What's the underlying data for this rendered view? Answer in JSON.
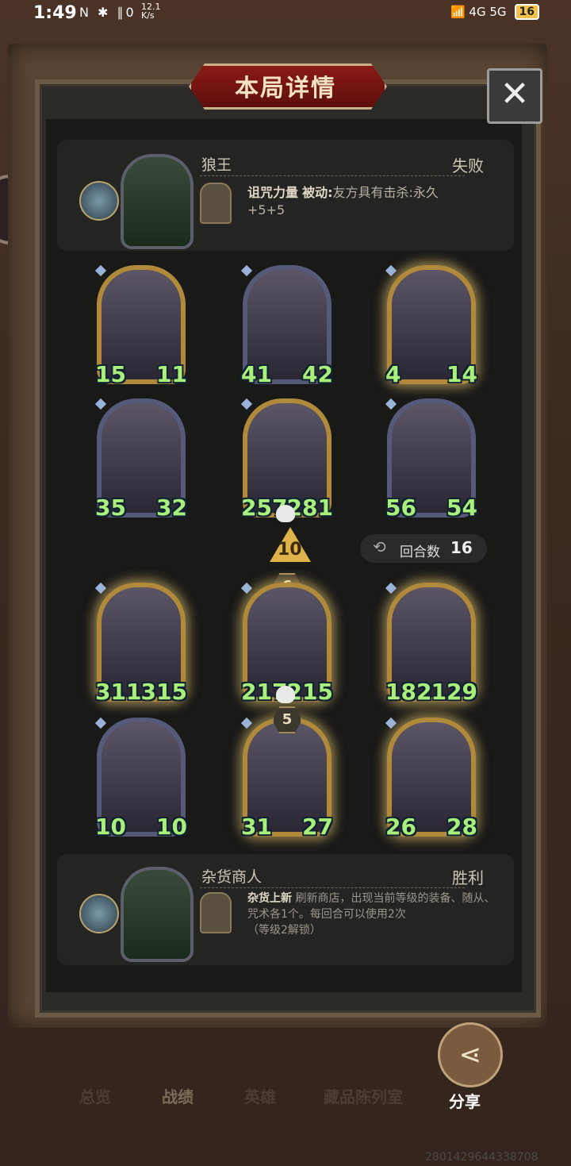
{
  "status_bar": {
    "time": "1:49",
    "left_icons": "N ✱ ∥0",
    "net_speed_top": "12.1",
    "net_speed_unit": "K/s",
    "right_icons": "📶 4G 5G",
    "battery": "16"
  },
  "title": "本局详情",
  "close_label": "✕",
  "top_player": {
    "name": "狼王",
    "result": "失败",
    "ability_name": "诅咒力量",
    "ability_type": "被动:",
    "ability_desc": "友方具有击杀:永久",
    "ability_desc2": "+5+5"
  },
  "bottom_player": {
    "name": "杂货商人",
    "result": "胜利",
    "ability_name": "杂货上新",
    "ability_desc": "刷新商店，出现当前等级的装备、随从、咒术各1个。每回合可以使用2次",
    "ability_note": "（等级2解锁）"
  },
  "opponent_cards": [
    {
      "atk": "15",
      "hp": "11",
      "frame": "gold"
    },
    {
      "atk": "41",
      "hp": "42",
      "frame": "blue"
    },
    {
      "atk": "4",
      "hp": "14",
      "frame": "gold"
    },
    {
      "atk": "35",
      "hp": "32",
      "frame": "blue"
    },
    {
      "atk": "257",
      "hp": "281",
      "frame": "gold"
    },
    {
      "atk": "56",
      "hp": "54",
      "frame": "blue"
    }
  ],
  "player_cards": [
    {
      "atk": "311",
      "hp": "315",
      "frame": "gold"
    },
    {
      "atk": "217",
      "hp": "215",
      "frame": "gold"
    },
    {
      "atk": "182",
      "hp": "129",
      "frame": "gold"
    },
    {
      "atk": "10",
      "hp": "10",
      "frame": "blue"
    },
    {
      "atk": "31",
      "hp": "27",
      "frame": "gold"
    },
    {
      "atk": "26",
      "hp": "28",
      "frame": "gold"
    }
  ],
  "attack_value": "10",
  "badge_6": "6",
  "badge_5": "5",
  "round_label": "回合数",
  "round_value": "16",
  "nav": {
    "overview": "总览",
    "record": "战绩",
    "hero": "英雄",
    "collection": "藏品陈列室",
    "share": "分享"
  },
  "uid": "2801429644338708"
}
